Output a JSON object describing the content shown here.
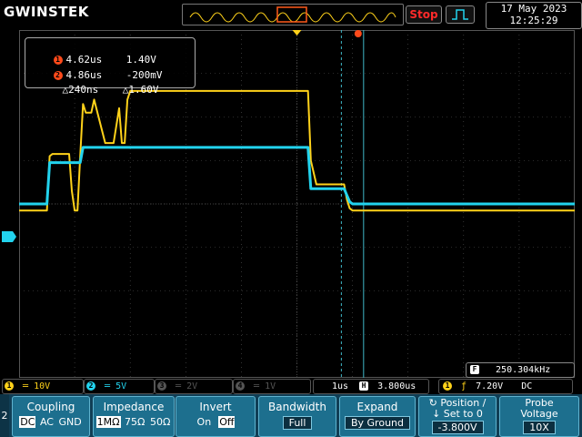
{
  "brand": "GWINSTEK",
  "run_state": "Stop",
  "date": "17 May 2023",
  "time": "12:25:29",
  "colors": {
    "ch1": "#ffd21a",
    "ch2": "#22d3ee",
    "cursor": "#3fb8c8",
    "grid": "#555555",
    "panel": "#1d6f8e"
  },
  "cursors": {
    "c1_time": "4.62us",
    "c1_volt": "1.40V",
    "c2_time": "4.86us",
    "c2_volt": "-200mV",
    "delta_time": "△240ns",
    "delta_volt": "△1.60V",
    "c1_badge": "1",
    "c2_badge": "2"
  },
  "status": {
    "ch1": "1",
    "ch1_scale": "10V",
    "ch2": "2",
    "ch2_scale": "5V",
    "ch3": "3",
    "ch3_scale": "2V",
    "ch4": "4",
    "ch4_scale": "1V",
    "timebase": "1us",
    "h_label": "H",
    "h_pos": "3.800us",
    "trig_ch": "1",
    "trig_level": "7.20V",
    "trig_coupling": "DC",
    "freq_label": "F",
    "freq": "250.304kHz"
  },
  "side_label": "2",
  "ch2_marker": "2",
  "softkeys": [
    {
      "title": "Coupling",
      "options": [
        "DC",
        "AC",
        "GND"
      ],
      "selected": 0
    },
    {
      "title": "Impedance",
      "options": [
        "1MΩ",
        "75Ω",
        "50Ω"
      ],
      "selected": 0
    },
    {
      "title": "Invert",
      "options": [
        "On",
        "Off"
      ],
      "selected": 1
    },
    {
      "title": "Bandwidth",
      "value": "Full"
    },
    {
      "title": "Expand",
      "value": "By Ground"
    },
    {
      "title": "↻ Position /",
      "title2": "↓ Set to 0",
      "value": "-3.800V"
    },
    {
      "title": "Probe",
      "title2": "Voltage",
      "value": "10X"
    }
  ],
  "chart_data": {
    "type": "line",
    "x_unit": "div",
    "y_unit": "div",
    "xlim": [
      0,
      10
    ],
    "ylim": [
      -4,
      4
    ],
    "grid": true,
    "series": [
      {
        "channel": "1",
        "x": [
          0,
          0.5,
          0.55,
          0.6,
          0.9,
          0.95,
          1.0,
          1.05,
          1.1,
          1.15,
          1.2,
          1.3,
          1.35,
          1.55,
          1.7,
          1.8,
          1.85,
          1.9,
          1.95,
          2.0,
          4.0,
          5.2,
          5.25,
          5.35,
          5.85,
          5.9,
          5.95,
          6.0,
          10.0
        ],
        "y": [
          -0.15,
          -0.15,
          1.1,
          1.15,
          1.15,
          0.3,
          -0.15,
          -0.15,
          1.1,
          2.3,
          2.1,
          2.1,
          2.4,
          1.4,
          1.4,
          2.2,
          1.4,
          1.4,
          2.4,
          2.6,
          2.6,
          2.6,
          1.0,
          0.45,
          0.45,
          0.1,
          -0.1,
          -0.15,
          -0.15
        ]
      },
      {
        "channel": "2",
        "x": [
          0,
          0.5,
          0.55,
          1.1,
          1.15,
          1.15,
          5.2,
          5.25,
          5.85,
          5.95,
          6.0,
          10.0
        ],
        "y": [
          0.0,
          0.0,
          0.95,
          0.95,
          1.3,
          1.3,
          1.3,
          0.35,
          0.35,
          0.05,
          0.0,
          0.0
        ]
      }
    ],
    "cursor_x": [
      5.8,
      6.2
    ]
  }
}
